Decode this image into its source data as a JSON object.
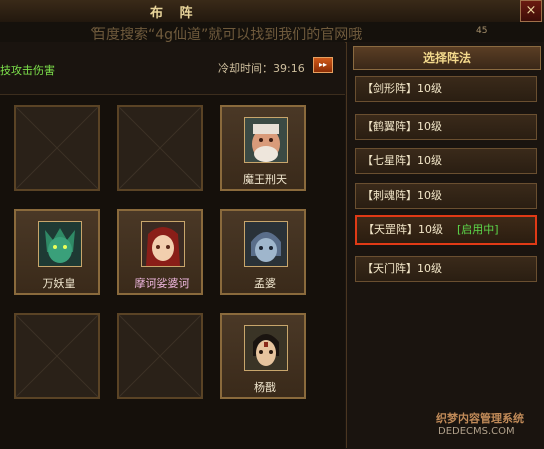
{
  "window": {
    "title": "布 阵",
    "close": "×",
    "badge": "45"
  },
  "notice": {
    "arrow": "«",
    "text": "百度搜索“4g仙道”就可以找到我们的官网哦"
  },
  "left": {
    "effect": "技攻击伤害",
    "cooldown": "冷却时间：39:16",
    "cooldown_btn": "▸▸"
  },
  "slots": [
    {
      "empty": true
    },
    {
      "empty": true
    },
    {
      "empty": false,
      "name": "魔王刑天",
      "portrait": "demon-king-portrait"
    },
    {
      "empty": false,
      "name": "万妖皇",
      "portrait": "monster-emperor-portrait"
    },
    {
      "empty": false,
      "name": "摩诃娑婆诃",
      "portrait": "girl-hero-portrait",
      "pink": true
    },
    {
      "empty": false,
      "name": "孟婆",
      "portrait": "mengpo-portrait"
    },
    {
      "empty": true
    },
    {
      "empty": true
    },
    {
      "empty": false,
      "name": "杨戬",
      "portrait": "yangjian-portrait"
    }
  ],
  "right": {
    "header": "选择阵法",
    "formations": [
      {
        "label": "【剑形阵】10级"
      },
      {
        "label": "【鹤翼阵】10级"
      },
      {
        "label": "【七星阵】10级"
      },
      {
        "label": "【刺魂阵】10级"
      },
      {
        "label": "【天罡阵】10级",
        "tag": "[启用中]",
        "active": true
      },
      {
        "label": "【天门阵】10级"
      }
    ]
  },
  "watermark": {
    "line1": "织梦内容管理系统",
    "line2": "DEDECMS.COM"
  },
  "colors": {
    "active_border": "#e03a16",
    "active_tag": "#5cd84a",
    "effect_text": "#7de24b"
  }
}
